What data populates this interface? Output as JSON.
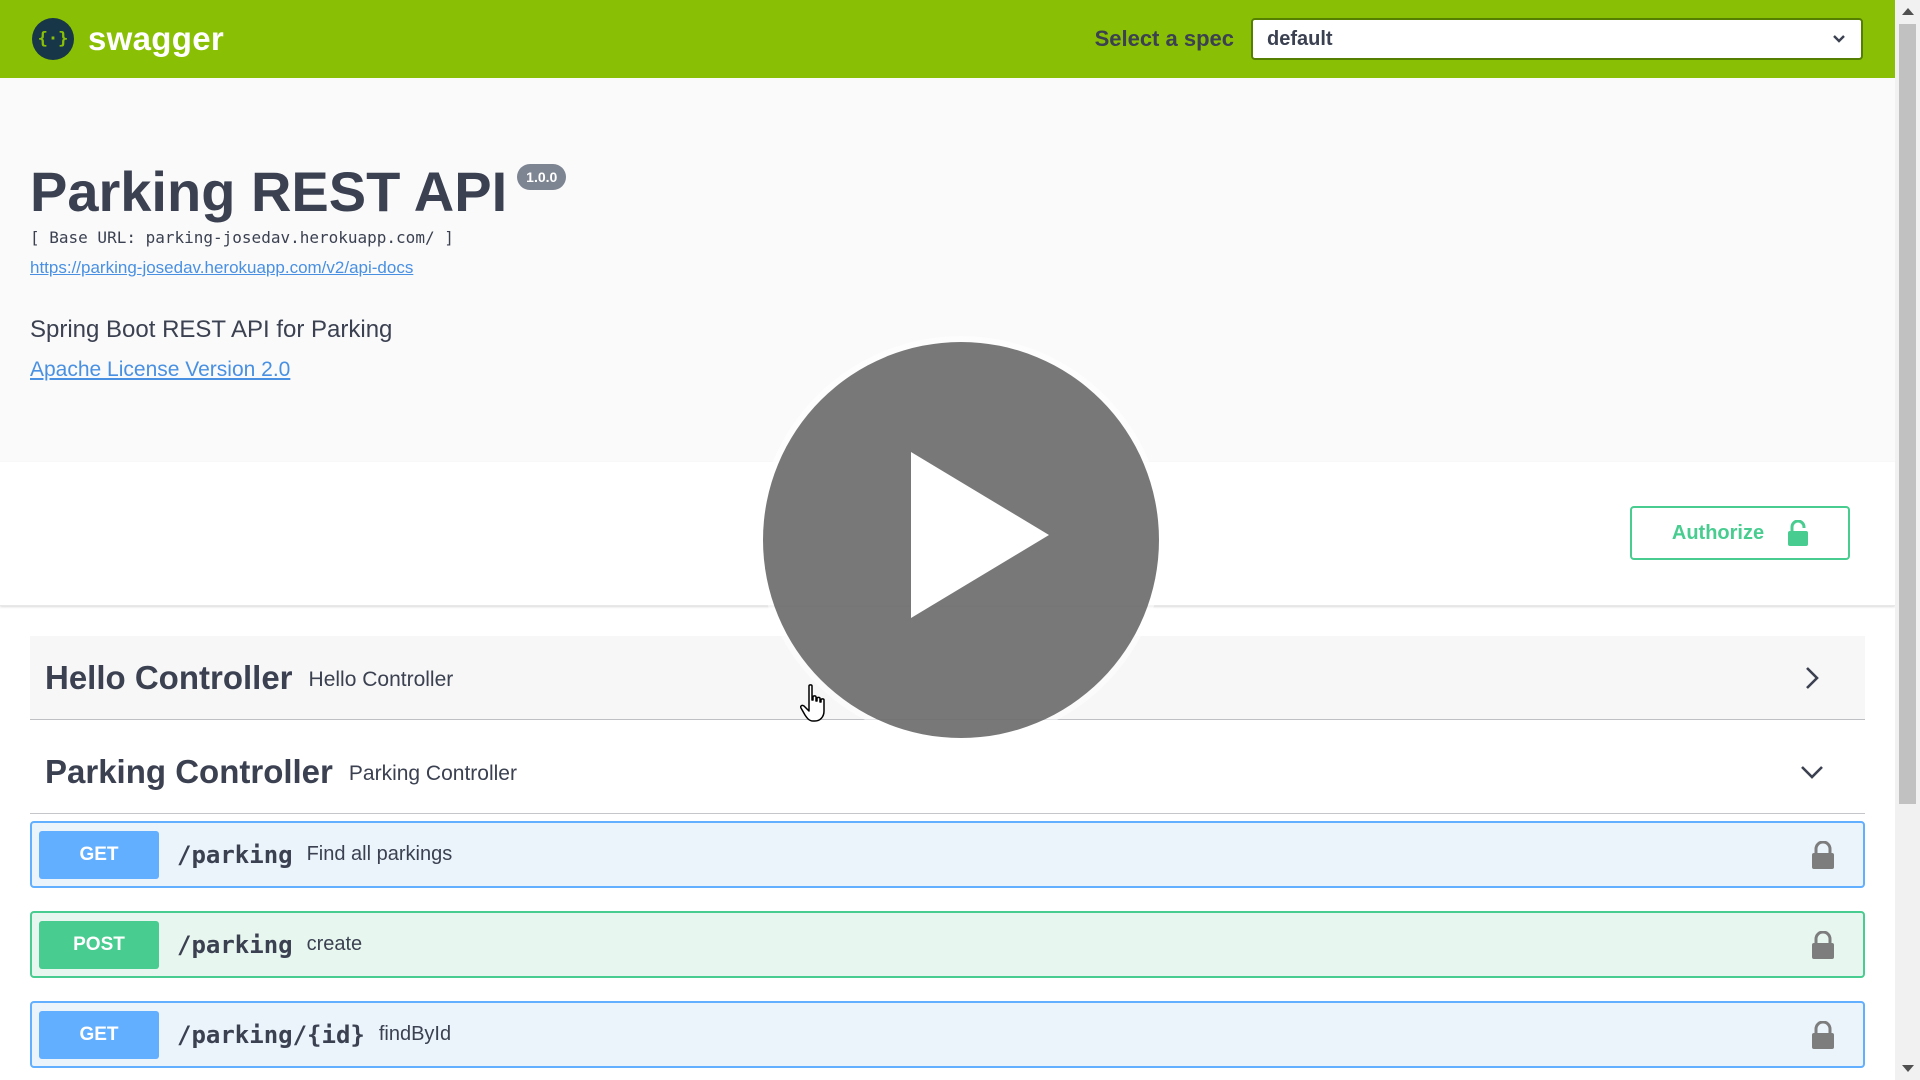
{
  "header": {
    "logo_text": "swagger",
    "logo_glyph": "{·}",
    "spec_label": "Select a spec",
    "spec_value": "default",
    "background_color": "#89bf04"
  },
  "info": {
    "title": "Parking REST API",
    "version": "1.0.0",
    "base_url": "[ Base URL: parking-josedav.herokuapp.com/ ]",
    "api_docs_url": "https://parking-josedav.herokuapp.com/v2/api-docs",
    "description": "Spring Boot REST API for Parking",
    "license": "Apache License Version 2.0"
  },
  "authorize": {
    "label": "Authorize",
    "color": "#49cc90"
  },
  "controllers": [
    {
      "name": "Hello Controller",
      "description": "Hello Controller",
      "expanded": false
    },
    {
      "name": "Parking Controller",
      "description": "Parking Controller",
      "expanded": true
    }
  ],
  "operations": [
    {
      "method": "GET",
      "path": "/parking",
      "summary": "Find all parkings",
      "color": "#61affe"
    },
    {
      "method": "POST",
      "path": "/parking",
      "summary": "create",
      "color": "#49cc90"
    },
    {
      "method": "GET",
      "path": "/parking/{id}",
      "summary": "findById",
      "color": "#61affe"
    }
  ],
  "overlay": {
    "icon": "play-icon"
  }
}
